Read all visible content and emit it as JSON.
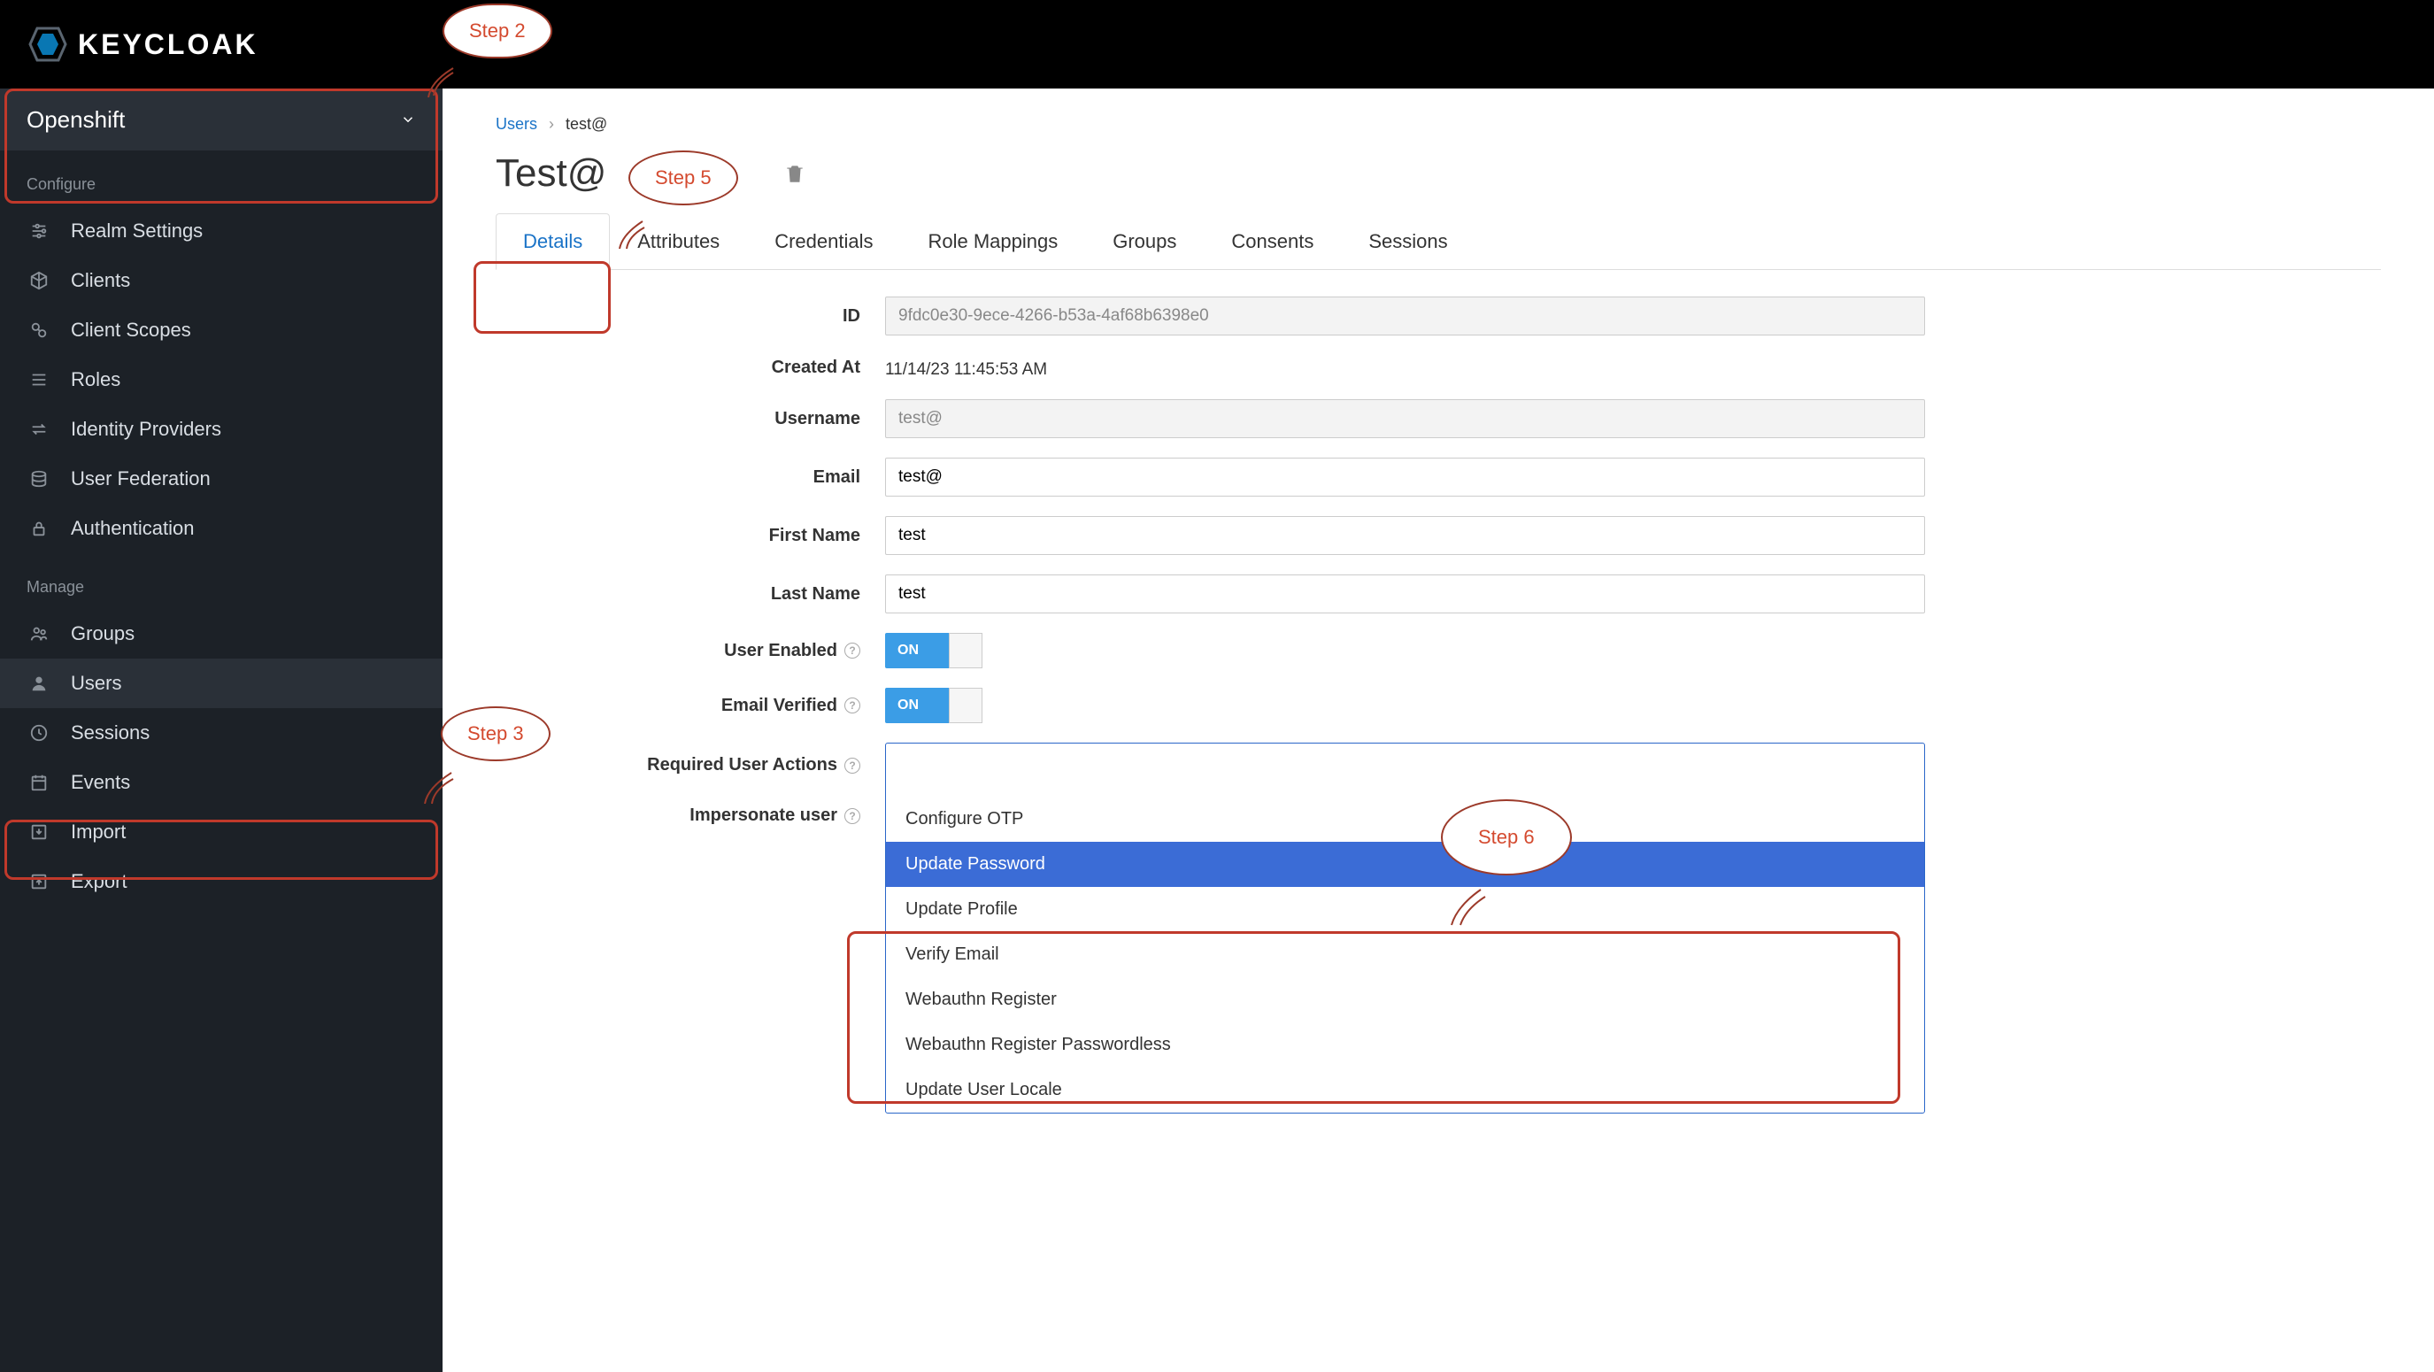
{
  "brand": "KEYCLOAK",
  "realm": "Openshift",
  "sidebar": {
    "sections": [
      {
        "title": "Configure",
        "items": [
          {
            "label": "Realm Settings",
            "icon": "sliders"
          },
          {
            "label": "Clients",
            "icon": "cube"
          },
          {
            "label": "Client Scopes",
            "icon": "scopes"
          },
          {
            "label": "Roles",
            "icon": "list"
          },
          {
            "label": "Identity Providers",
            "icon": "exchange"
          },
          {
            "label": "User Federation",
            "icon": "database"
          },
          {
            "label": "Authentication",
            "icon": "lock"
          }
        ]
      },
      {
        "title": "Manage",
        "items": [
          {
            "label": "Groups",
            "icon": "group"
          },
          {
            "label": "Users",
            "icon": "user",
            "active": true
          },
          {
            "label": "Sessions",
            "icon": "clock"
          },
          {
            "label": "Events",
            "icon": "calendar"
          },
          {
            "label": "Import",
            "icon": "import"
          },
          {
            "label": "Export",
            "icon": "export"
          }
        ]
      }
    ]
  },
  "breadcrumb": {
    "root": "Users",
    "current": "test@"
  },
  "page_title": "Test@",
  "tabs": [
    "Details",
    "Attributes",
    "Credentials",
    "Role Mappings",
    "Groups",
    "Consents",
    "Sessions"
  ],
  "active_tab": 0,
  "form": {
    "id": {
      "label": "ID",
      "value": "9fdc0e30-9ece-4266-b53a-4af68b6398e0"
    },
    "created_at": {
      "label": "Created At",
      "value": "11/14/23 11:45:53 AM"
    },
    "username": {
      "label": "Username",
      "value": "test@"
    },
    "email": {
      "label": "Email",
      "value": "test@"
    },
    "first_name": {
      "label": "First Name",
      "value": "test"
    },
    "last_name": {
      "label": "Last Name",
      "value": "test"
    },
    "user_enabled": {
      "label": "User Enabled",
      "on_text": "ON"
    },
    "email_verified": {
      "label": "Email Verified",
      "on_text": "ON"
    },
    "required_actions": {
      "label": "Required User Actions"
    },
    "impersonate": {
      "label": "Impersonate user"
    }
  },
  "required_actions_options": [
    "Configure OTP",
    "Update Password",
    "Update Profile",
    "Verify Email",
    "Webauthn Register",
    "Webauthn Register Passwordless",
    "Update User Locale"
  ],
  "required_actions_selected_index": 1,
  "annotations": {
    "step2": "Step 2",
    "step3": "Step 3",
    "step5": "Step 5",
    "step6": "Step 6"
  }
}
